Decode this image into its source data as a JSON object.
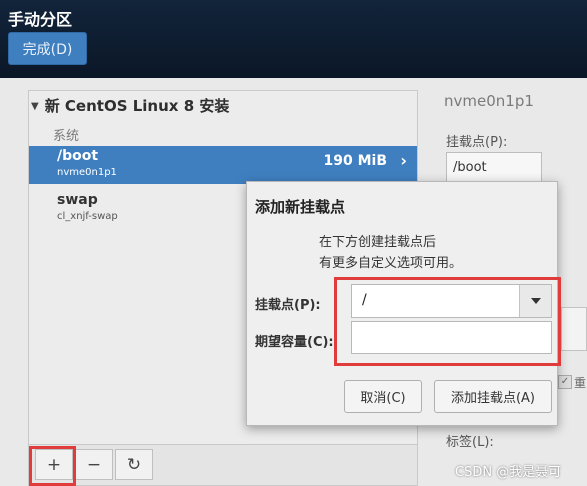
{
  "header": {
    "title": "手动分区",
    "done_button": "完成(D)"
  },
  "left_panel": {
    "group_label": "新 CentOS Linux 8 安装",
    "section_label": "系统",
    "partitions": [
      {
        "name": "/boot",
        "device": "nvme0n1p1",
        "size": "190 MiB",
        "selected": true
      },
      {
        "name": "swap",
        "device": "cl_xnjf-swap",
        "size": "",
        "selected": false
      }
    ]
  },
  "toolbar": {
    "add": "+",
    "remove": "−",
    "refresh": "↻"
  },
  "details": {
    "device_title": "nvme0n1p1",
    "mount_point_label": "挂载点(P):",
    "mount_point_value": "/boot",
    "check_label": "重",
    "tags_label": "标签(L):"
  },
  "dialog": {
    "title": "添加新挂载点",
    "description_line1": "在下方创建挂载点后",
    "description_line2": "有更多自定义选项可用。",
    "mount_label": "挂载点(P):",
    "mount_value": "/",
    "capacity_label": "期望容量(C):",
    "capacity_value": "",
    "cancel_button": "取消(C)",
    "add_button": "添加挂载点(A)"
  },
  "watermark": "CSDN @我是聂可",
  "colors": {
    "accent": "#3f7fbf",
    "highlight": "#e03c3c",
    "header_bg": "#12243b"
  }
}
